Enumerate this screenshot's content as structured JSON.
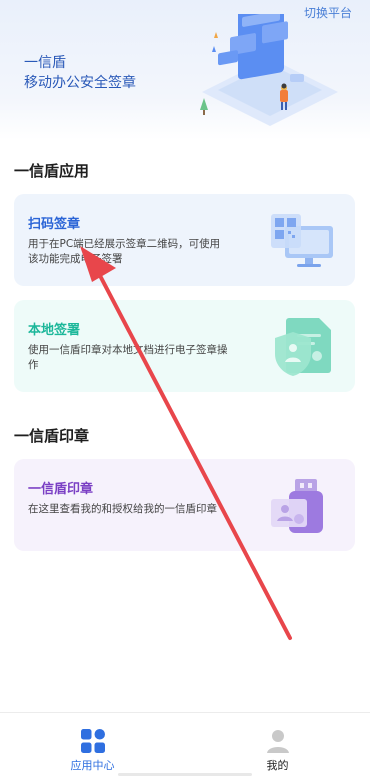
{
  "header": {
    "switch_platform": "切换平台",
    "brand_title": "一信盾",
    "brand_subtitle": "移动办公安全签章"
  },
  "sections": {
    "apps_title": "一信盾应用",
    "seal_title": "一信盾印章"
  },
  "cards": {
    "scan": {
      "title": "扫码签章",
      "desc": "用于在PC端已经展示签章二维码，可使用该功能完成电子签署",
      "icon": "qr-monitor-icon"
    },
    "local": {
      "title": "本地签署",
      "desc": "使用一信盾印章对本地文档进行电子签章操作",
      "icon": "document-shield-icon"
    },
    "seal": {
      "title": "一信盾印章",
      "desc": "在这里查看我的和授权给我的一信盾印章",
      "icon": "usb-key-icon"
    }
  },
  "tabbar": {
    "apps_label": "应用中心",
    "me_label": "我的"
  },
  "colors": {
    "brand_blue": "#2a64d6",
    "green": "#1cb79a",
    "purple": "#7a3fc4",
    "annotation_arrow": "#e8464b"
  }
}
